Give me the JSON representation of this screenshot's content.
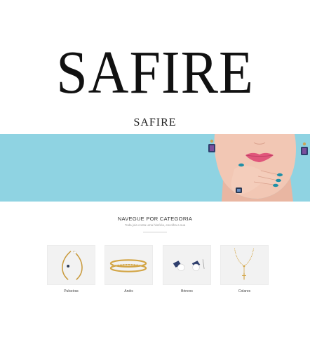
{
  "brand": {
    "name_large": "SAFIRE",
    "name_header": "SAFIRE"
  },
  "colors": {
    "hero_background": "#8fd3e2",
    "text": "#222222",
    "card_background": "#f2f2f2"
  },
  "categories_section": {
    "title": "NAVEGUE POR CATEGORIA",
    "subtitle": "Toda joia conta uma história, escolha a sua",
    "items": [
      {
        "label": "Pulseiras",
        "icon": "bracelet-image"
      },
      {
        "label": "Anéis",
        "icon": "ring-image"
      },
      {
        "label": "Brincos",
        "icon": "earrings-image"
      },
      {
        "label": "Colares",
        "icon": "necklace-image"
      }
    ]
  }
}
